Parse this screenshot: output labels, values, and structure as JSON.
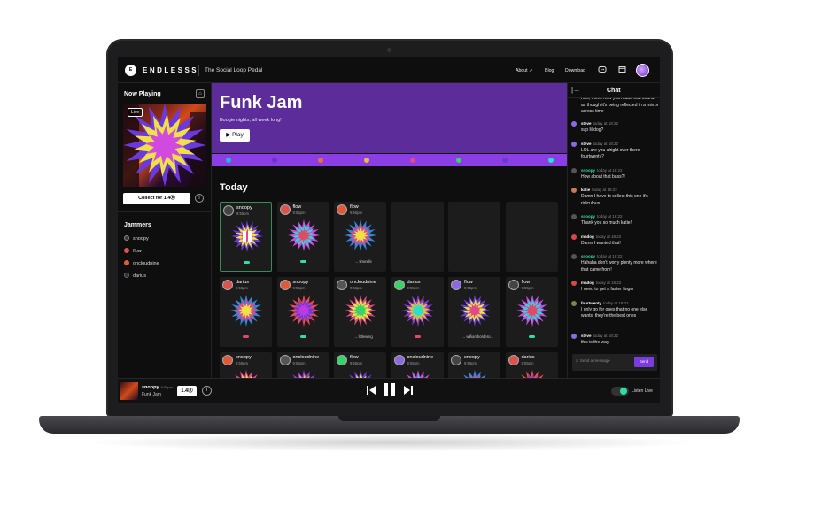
{
  "app": {
    "brand": "ENDLESSS",
    "logo_text": "E",
    "tagline": "The Social Loop Pedal"
  },
  "nav": {
    "about": "About ↗",
    "blog": "Blog",
    "download": "Download",
    "icons": [
      "discord-icon",
      "window-icon",
      "user-avatar"
    ]
  },
  "now_playing": {
    "title": "Now Playing",
    "live_badge": "Live",
    "collect_button": "Collect for 1.4Ⓡ",
    "info": "i"
  },
  "jammers": {
    "title": "Jammers",
    "list": [
      "snoopy",
      "flow",
      "oncloudnine",
      "darius"
    ],
    "colors": [
      "#3b3b3b",
      "#d9534f",
      "#e05a3a",
      "#333333"
    ]
  },
  "hero": {
    "title": "Funk Jam",
    "subtitle": "Boogie nights, all week long!",
    "play_button": "▶ Play",
    "accent": "#5c2c9a",
    "strip_colors": [
      "#2bb3e0",
      "#6a35c9",
      "#f06a3a",
      "#f0b93a",
      "#e04a8a",
      "#3ad06a",
      "#6a3ac9",
      "#2be0c9"
    ]
  },
  "today": {
    "title": "Today",
    "rows": [
      [
        {
          "name": "snoopy",
          "time": "9:55pm",
          "pill": "#2be0a8",
          "via": "",
          "playing": true
        },
        {
          "name": "flow",
          "time": "9:55pm",
          "pill": "#2be0a8",
          "via": ""
        },
        {
          "name": "flow",
          "time": "9:55pm",
          "pill": "",
          "via": "→ timexife"
        },
        {
          "name": "",
          "time": "",
          "pill": "",
          "via": ""
        },
        {
          "name": "",
          "time": "",
          "pill": "",
          "via": ""
        },
        {
          "name": "",
          "time": "",
          "pill": "",
          "via": ""
        }
      ],
      [
        {
          "name": "darius",
          "time": "9:55pm",
          "pill": "#e04a6a",
          "via": ""
        },
        {
          "name": "snoopy",
          "time": "9:55pm",
          "pill": "#2be0a8",
          "via": ""
        },
        {
          "name": "oncloudnine",
          "time": "9:55pm",
          "pill": "",
          "via": "→ littlewing"
        },
        {
          "name": "darius",
          "time": "9:55pm",
          "pill": "#e04a6a",
          "via": ""
        },
        {
          "name": "flow",
          "time": "9:55pm",
          "pill": "",
          "via": "→ williambordero..."
        },
        {
          "name": "flow",
          "time": "9:55pm",
          "pill": "#2be0a8",
          "via": ""
        }
      ],
      [
        {
          "name": "snoopy",
          "time": "9:55pm",
          "pill": "",
          "via": ""
        },
        {
          "name": "oncloudnine",
          "time": "9:55pm",
          "pill": "",
          "via": ""
        },
        {
          "name": "flow",
          "time": "9:55pm",
          "pill": "",
          "via": ""
        },
        {
          "name": "oncloudnine",
          "time": "9:55pm",
          "pill": "",
          "via": ""
        },
        {
          "name": "snoopy",
          "time": "9:55pm",
          "pill": "",
          "via": ""
        },
        {
          "name": "darius",
          "time": "9:55pm",
          "pill": "",
          "via": ""
        }
      ]
    ]
  },
  "chat": {
    "title": "Chat",
    "top_text": "nice, I love how you made that sound as though it's being reflected in a mirror across time",
    "messages": [
      {
        "user": "steve",
        "time": "today at 18:22",
        "text": "sup lil dog?",
        "color": "#8a6ae0"
      },
      {
        "user": "steve",
        "time": "today at 18:22",
        "text": "LOL are you alright over there fourtwenty?",
        "color": "#8a6ae0"
      },
      {
        "user": "snoopy",
        "time": "today at 18:22",
        "text": "How about that bass?!",
        "color": "#555555",
        "name_color": "#2be0a8"
      },
      {
        "user": "katie",
        "time": "today at 18:22",
        "text": "Damn I have to collect this one it's ridiculous",
        "color": "#c77a5a"
      },
      {
        "user": "snoopy",
        "time": "today at 18:22",
        "text": "Thank you so much katie!",
        "color": "#555555",
        "name_color": "#2be0a8"
      },
      {
        "user": "madog",
        "time": "today at 18:22",
        "text": "Damn I wanted that!",
        "color": "#d04a4a"
      },
      {
        "user": "snoopy",
        "time": "today at 18:22",
        "text": "Hahaha don't worry plenty more where that came from!",
        "color": "#555555",
        "name_color": "#2be0a8"
      },
      {
        "user": "madog",
        "time": "today at 18:22",
        "text": "I need to get a faster finger",
        "color": "#d04a4a"
      },
      {
        "user": "fourtwenty",
        "time": "today at 18:22",
        "text": "I only go for ones that no one else wants, they're the best ones",
        "color": "#7a8a4a"
      },
      {
        "user": "steve",
        "time": "today at 18:22",
        "text": "this is the way",
        "color": "#8a6ae0"
      }
    ],
    "input_placeholder": "Send a message",
    "send_button": "Send"
  },
  "player": {
    "name": "snoopy",
    "by": "9:55pm",
    "jam": "Funk Jam",
    "collect": "1.4Ⓡ",
    "info": "i",
    "listen_live": "Listen Live"
  }
}
